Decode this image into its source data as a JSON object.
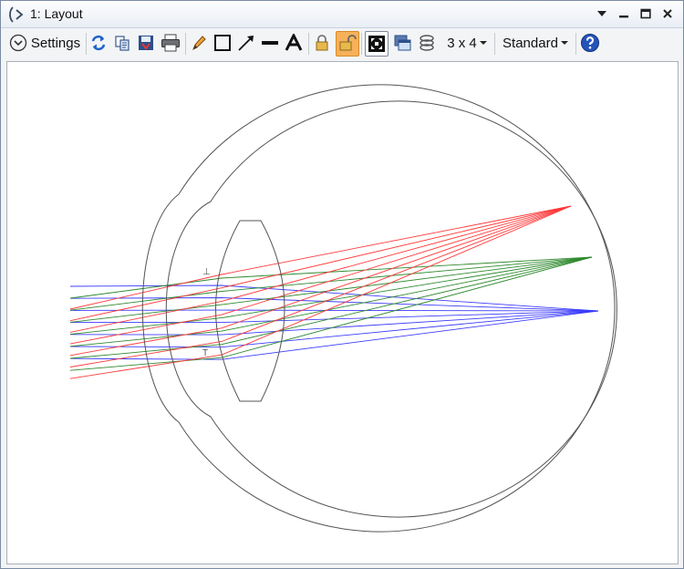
{
  "window": {
    "title": "1: Layout"
  },
  "toolbar": {
    "settings_label": "Settings",
    "grid_size": "3 x 4",
    "view_mode": "Standard"
  },
  "canvas": {
    "markers": [
      "⊥",
      "T"
    ]
  },
  "colors": {
    "ray_blue": "#3d3dfc",
    "ray_green": "#2f8a2f",
    "ray_red": "#ff3a3a",
    "outline": "#555555",
    "active_tool": "#f6b15a"
  },
  "icons": [
    "layout-window-icon",
    "dropdown-icon",
    "minimize-icon",
    "restore-icon",
    "close-icon",
    "settings-chevron-icon",
    "refresh-icon",
    "copy-icon",
    "save-icon",
    "print-icon",
    "pencil-icon",
    "rectangle-icon",
    "arrow-icon",
    "line-icon",
    "text-icon",
    "lock-icon",
    "unlock-icon",
    "fit-icon",
    "window-icon",
    "layers-icon",
    "help-icon"
  ]
}
